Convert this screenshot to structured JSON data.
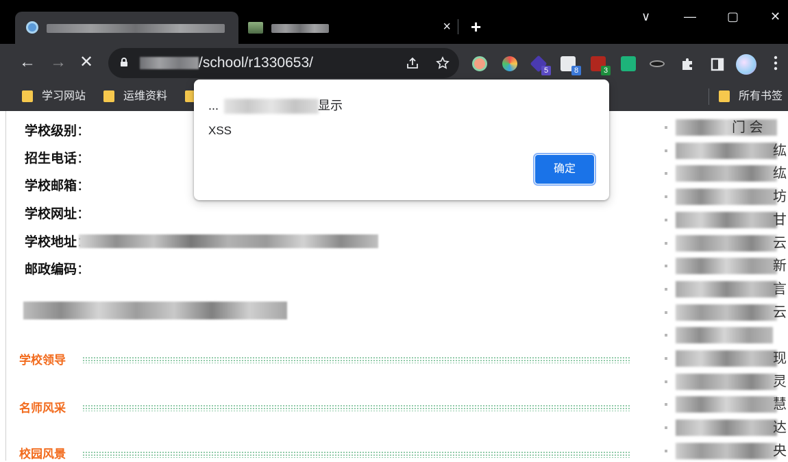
{
  "browser": {
    "active_tab": {
      "close_glyph": "×"
    },
    "new_tab_glyph": "+",
    "window_controls": {
      "minimize": "—",
      "maximize": "▢",
      "close": "✕",
      "tab_search": "∨"
    },
    "nav": {
      "back": "←",
      "forward": "→",
      "stop": "✕"
    },
    "address_bar": {
      "url_visible": "/school/r1330653/"
    },
    "extensions": [
      {
        "icon": "circle-extension-icon",
        "color": "#f4a083"
      },
      {
        "icon": "color-wheel-extension-icon",
        "color": "#3ba3dc"
      },
      {
        "icon": "cube-extension-icon",
        "badge": "5",
        "badge_color": "#5b4bc4"
      },
      {
        "icon": "face-extension-icon",
        "badge": "8",
        "badge_color": "#3b78d8"
      },
      {
        "icon": "monster-extension-icon",
        "badge": "3",
        "badge_color": "#1e8e3e"
      },
      {
        "icon": "chat-extension-icon",
        "color": "#1db37a"
      },
      {
        "icon": "hat-extension-icon"
      },
      {
        "icon": "puzzle-icon"
      },
      {
        "icon": "sidepanel-icon"
      },
      {
        "icon": "profile-avatar"
      },
      {
        "icon": "menu-icon"
      }
    ],
    "bookmarks": [
      "学习网站",
      "运维资料",
      "所有书签"
    ]
  },
  "page": {
    "info_labels": [
      "学校级别",
      "招生电话",
      "学校邮箱",
      "学校网址",
      "学校地址",
      "邮政编码"
    ],
    "sections": [
      "学校领导",
      "名师风采",
      "校园风景"
    ],
    "right_list_chars": [
      "门 会 ",
      "纮",
      "纮",
      "坊",
      "甘",
      "云",
      "新",
      "言",
      "云",
      "",
      "现",
      "灵",
      "慧",
      "达",
      "央"
    ]
  },
  "dialog": {
    "title_prefix": "...",
    "title_suffix": "显示",
    "message": "XSS",
    "ok_button": "确定"
  }
}
